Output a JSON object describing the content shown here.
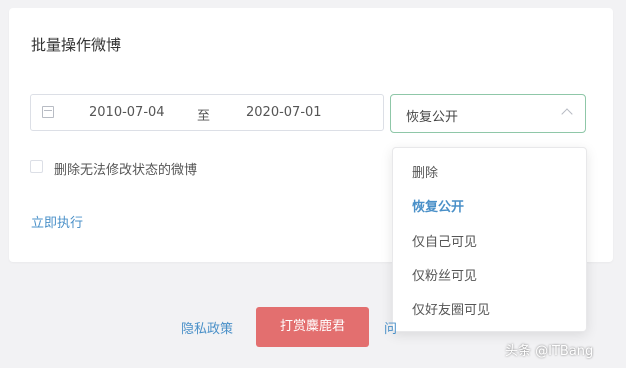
{
  "card": {
    "title": "批量操作微博",
    "date_range": {
      "start": "2010-07-04",
      "separator": "至",
      "end": "2020-07-01"
    },
    "action_select": {
      "value": "恢复公开",
      "options": [
        "删除",
        "恢复公开",
        "仅自己可见",
        "仅粉丝可见",
        "仅好友圈可见"
      ],
      "selected_index": 1,
      "border_color": "#8fc7a8"
    },
    "checkbox_label": "删除无法修改状态的微博",
    "execute_link": "立即执行"
  },
  "footer": {
    "privacy_link": "隐私政策",
    "reward_button": "打赏麋鹿君",
    "partial_link": "问"
  },
  "watermark": "头条 @ITBang",
  "colors": {
    "link": "#4a90c8",
    "reward_button": "#e36f6f",
    "background": "#f2f2f4"
  }
}
